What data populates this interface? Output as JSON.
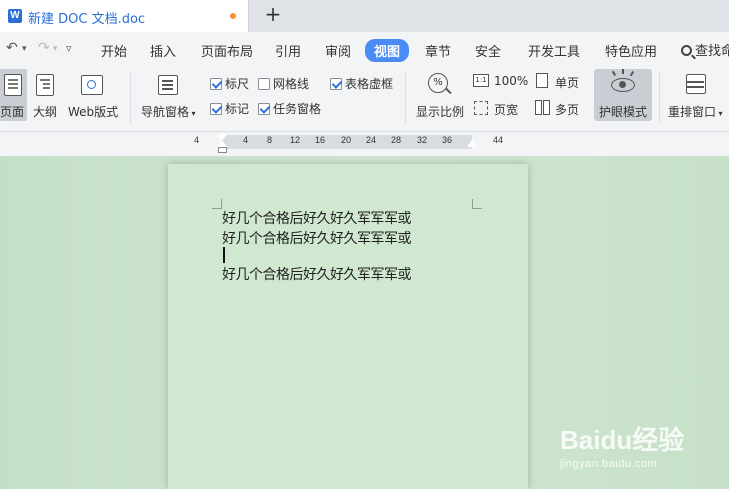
{
  "tab": {
    "logo": "W",
    "title": "新建 DOC 文档.doc",
    "unsaved_color": "#f0903c"
  },
  "new_tab": "+",
  "quick": {
    "undo": "↶",
    "undo_menu": "▾",
    "redo": "↷",
    "redo_menu": "▾",
    "customize": "▿"
  },
  "menu": {
    "items": [
      "开始",
      "插入",
      "页面布局",
      "引用",
      "审阅",
      "视图",
      "章节",
      "安全",
      "开发工具",
      "特色应用"
    ],
    "active": "视图",
    "search_label": "查找命"
  },
  "toolbar": {
    "page_view": "页面",
    "outline": "大纲",
    "web_layout": "Web版式",
    "nav_pane": "导航窗格",
    "ruler": "标尺",
    "gridlines": "网格线",
    "table_gridlines": "表格虚框",
    "marks": "标记",
    "task_pane": "任务窗格",
    "zoom": "显示比例",
    "zoom_100": "100%",
    "one_page": "单页",
    "page_width": "页宽",
    "multi_page": "多页",
    "eye_mode": "护眼模式",
    "rearrange": "重排窗口",
    "checks": {
      "ruler": true,
      "gridlines": false,
      "table_gridlines": true,
      "marks": true,
      "task_pane": true
    }
  },
  "ruler": {
    "ticks": [
      "4",
      "4",
      "8",
      "12",
      "16",
      "20",
      "24",
      "28",
      "32",
      "36",
      "44"
    ]
  },
  "document": {
    "lines": [
      "好几个合格后好久好久军军军或",
      "好几个合格后好久好久军军军或",
      "",
      "好几个合格后好久好久军军军或"
    ]
  },
  "watermark": {
    "brand": "Baidu经验",
    "url": "jingyan.baidu.com"
  },
  "colors": {
    "accent": "#4a8bf5",
    "page_bg": "#cfe8cf",
    "workspace_bg": "#c5dfc7"
  }
}
